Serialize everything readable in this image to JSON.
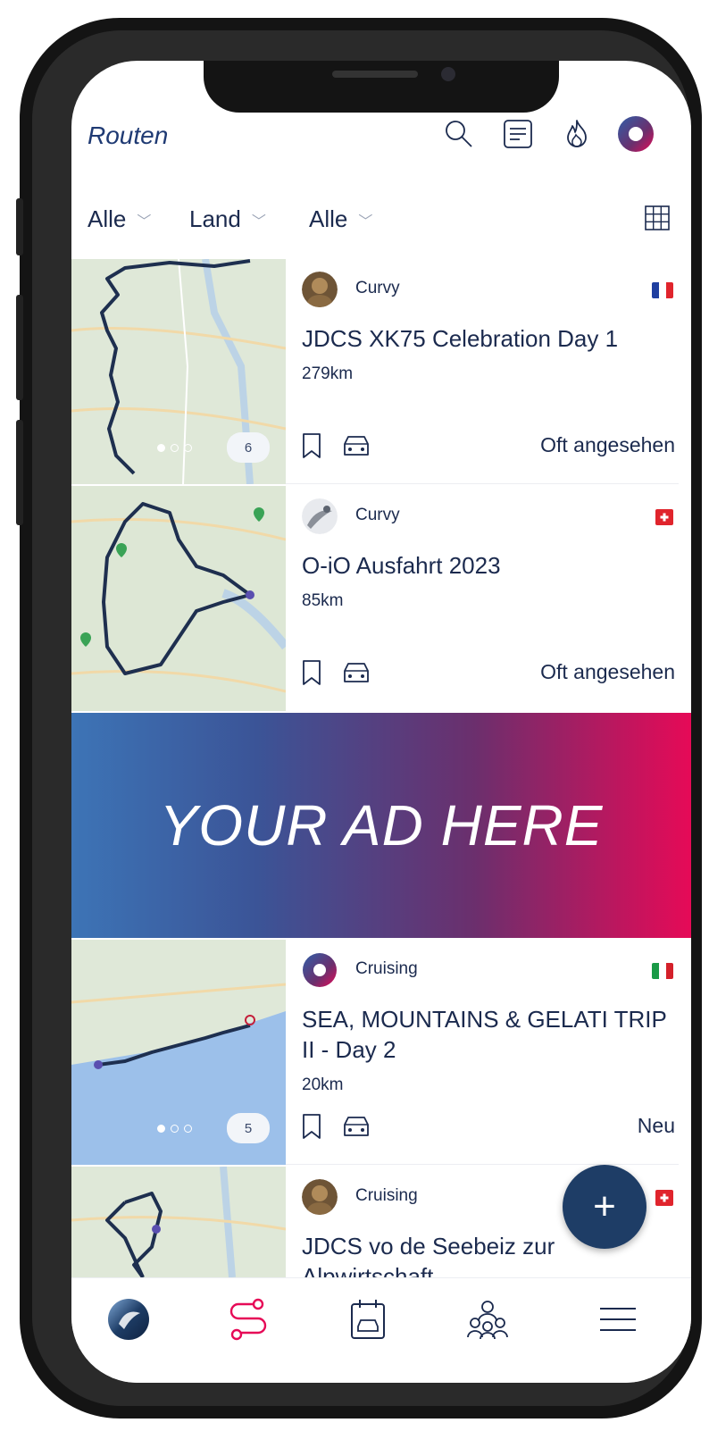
{
  "header": {
    "title": "Routen"
  },
  "filters": [
    {
      "label": "Alle"
    },
    {
      "label": "Land"
    },
    {
      "label": "Alle"
    }
  ],
  "routes": [
    {
      "style": "Curvy",
      "title": "JDCS XK75 Celebration Day 1",
      "distance": "279km",
      "status": "Oft angesehen",
      "image_count": "6",
      "country_flag": "france-flag"
    },
    {
      "style": "Curvy",
      "title": "O-iO Ausfahrt 2023",
      "distance": "85km",
      "status": "Oft angesehen",
      "country_flag": "switzerland-flag"
    },
    {
      "style": "Cruising",
      "title": "SEA, MOUNTAINS & GELATI TRIP II - Day 2",
      "distance": "20km",
      "status": "Neu",
      "image_count": "5",
      "country_flag": "italy-flag"
    },
    {
      "style": "Cruising",
      "title": "JDCS vo de Seebeiz zur Alpwirtschaft",
      "country_flag": "switzerland-flag"
    }
  ],
  "ad": {
    "text": "YOUR AD HERE"
  },
  "fab": {
    "label": "+"
  },
  "colors": {
    "primary_navy": "#1e3d66",
    "accent_red": "#e60a57",
    "text_dark": "#1b2a4e"
  }
}
